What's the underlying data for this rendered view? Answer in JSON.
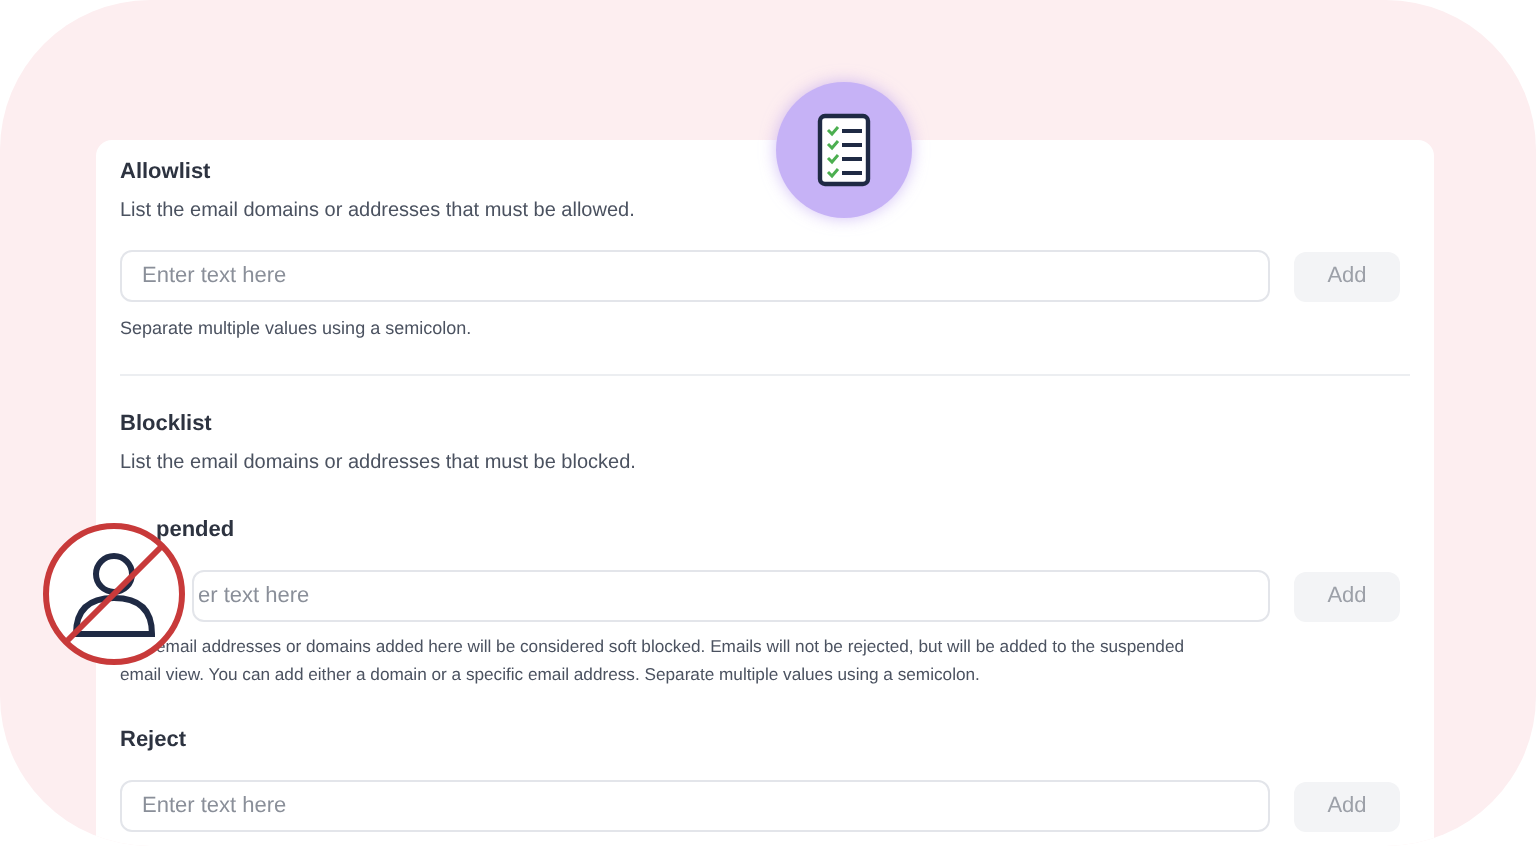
{
  "allowlist": {
    "title": "Allowlist",
    "description": "List the email domains or addresses that must be allowed.",
    "placeholder": "Enter text here",
    "button": {
      "label": "Add",
      "disabled": true
    },
    "help": "Separate multiple values using a semicolon."
  },
  "blocklist": {
    "title": "Blocklist",
    "description": "List the email domains or addresses that must be blocked.",
    "groups": [
      {
        "title": "pended",
        "placeholder": "er text here",
        "button": {
          "label": "Add",
          "disabled": true
        },
        "help": "email addresses or domains added here will be considered soft blocked. Emails will not be rejected, but will be added to the suspended email view. You can add either a domain or a specific email address. Separate multiple values using a semicolon.",
        "covered": true
      },
      {
        "title": "Reject",
        "placeholder": "Enter text here",
        "button": {
          "label": "Add",
          "disabled": true
        },
        "covered": false
      }
    ]
  }
}
